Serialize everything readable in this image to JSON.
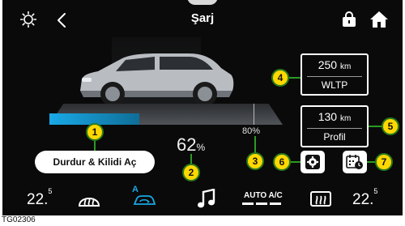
{
  "header": {
    "title": "Şarj",
    "icons": [
      "brightness-icon",
      "back-icon",
      "unlock-icon",
      "home-icon"
    ]
  },
  "charge": {
    "level": "62",
    "level_unit": "%",
    "level_fraction": 0.62,
    "limit_label": "80%",
    "limit_fraction": 0.8,
    "stop_unlock_label": "Durdur & Kilidi Aç"
  },
  "range_boxes": [
    {
      "value": "250",
      "unit": "km",
      "label": "WLTP"
    },
    {
      "value": "130",
      "unit": "km",
      "label": "Profil"
    }
  ],
  "callouts": [
    "1",
    "2",
    "3",
    "4",
    "5",
    "6",
    "7"
  ],
  "bottom_bar": {
    "temp_left": "22.",
    "temp_left_sup": "5",
    "temp_right": "22.",
    "temp_right_sup": "5",
    "ac_label": "AUTO A/C",
    "recirc_letter": "A",
    "icons": [
      "front-defrost-icon",
      "recirculation-icon",
      "music-icon",
      "rear-defrost-icon"
    ]
  },
  "figure_code": "TG02306",
  "colors": {
    "accent": "#19a9e6",
    "callout_fill": "#ffd800",
    "callout_line": "#2b9a23",
    "background": "#0a0a0a"
  }
}
